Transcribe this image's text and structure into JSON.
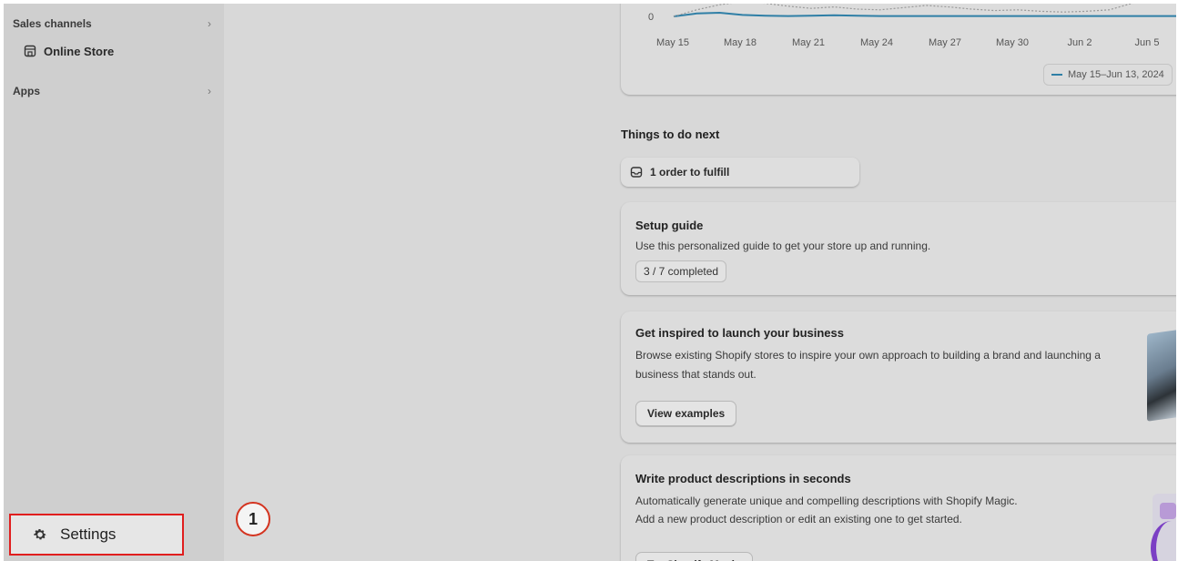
{
  "sidebar": {
    "sales_channels": {
      "label": "Sales channels",
      "chevron": "›"
    },
    "online_store": {
      "label": "Online Store",
      "icon": "store-icon"
    },
    "apps": {
      "label": "Apps",
      "chevron": "›"
    },
    "settings": {
      "label": "Settings",
      "icon": "gear-icon"
    }
  },
  "annotation": {
    "step": "1"
  },
  "chart_data": {
    "type": "line",
    "x_ticks": [
      "May 15",
      "May 18",
      "May 21",
      "May 24",
      "May 27",
      "May 30",
      "Jun 2",
      "Jun 5"
    ],
    "y_ticks": [
      "0"
    ],
    "legend": "May 15–Jun 13, 2024",
    "series": [
      {
        "name": "May 15–Jun 13, 2024",
        "color": "#2f7fa6",
        "values": [
          0,
          0.4,
          0.5,
          0.2,
          0.1,
          0.05,
          0.1,
          0.15,
          0.1,
          0.05,
          0.05,
          0.05,
          0.05,
          0.05,
          0.05,
          0.05,
          0.05,
          0.05,
          0.05,
          0.05,
          0.05,
          0.05,
          0.05
        ]
      },
      {
        "color": "#9a9a9a",
        "dashed": true,
        "values": [
          0,
          0.9,
          1.6,
          2.0,
          1.8,
          1.4,
          1.1,
          1.3,
          1.0,
          0.9,
          1.2,
          1.5,
          1.3,
          1.0,
          0.8,
          0.9,
          0.7,
          0.6,
          0.7,
          0.9,
          1.8,
          2.6,
          3.0
        ]
      }
    ]
  },
  "main": {
    "things_title": "Things to do next",
    "fulfill": {
      "label": "1 order to fulfill",
      "icon": "inbox-icon"
    },
    "setup_guide": {
      "title": "Setup guide",
      "desc": "Use this personalized guide to get your store up and running.",
      "progress": "3 / 7 completed"
    },
    "inspire": {
      "title": "Get inspired to launch your business",
      "desc": "Browse existing Shopify stores to inspire your own approach to building a brand and launching a business that stands out.",
      "button": "View examples"
    },
    "magic": {
      "title": "Write product descriptions in seconds",
      "desc_line1": "Automatically generate unique and compelling descriptions with Shopify Magic.",
      "desc_line2": "Add a new product description or edit an existing one to get started.",
      "button": "Try Shopify Magic"
    }
  }
}
